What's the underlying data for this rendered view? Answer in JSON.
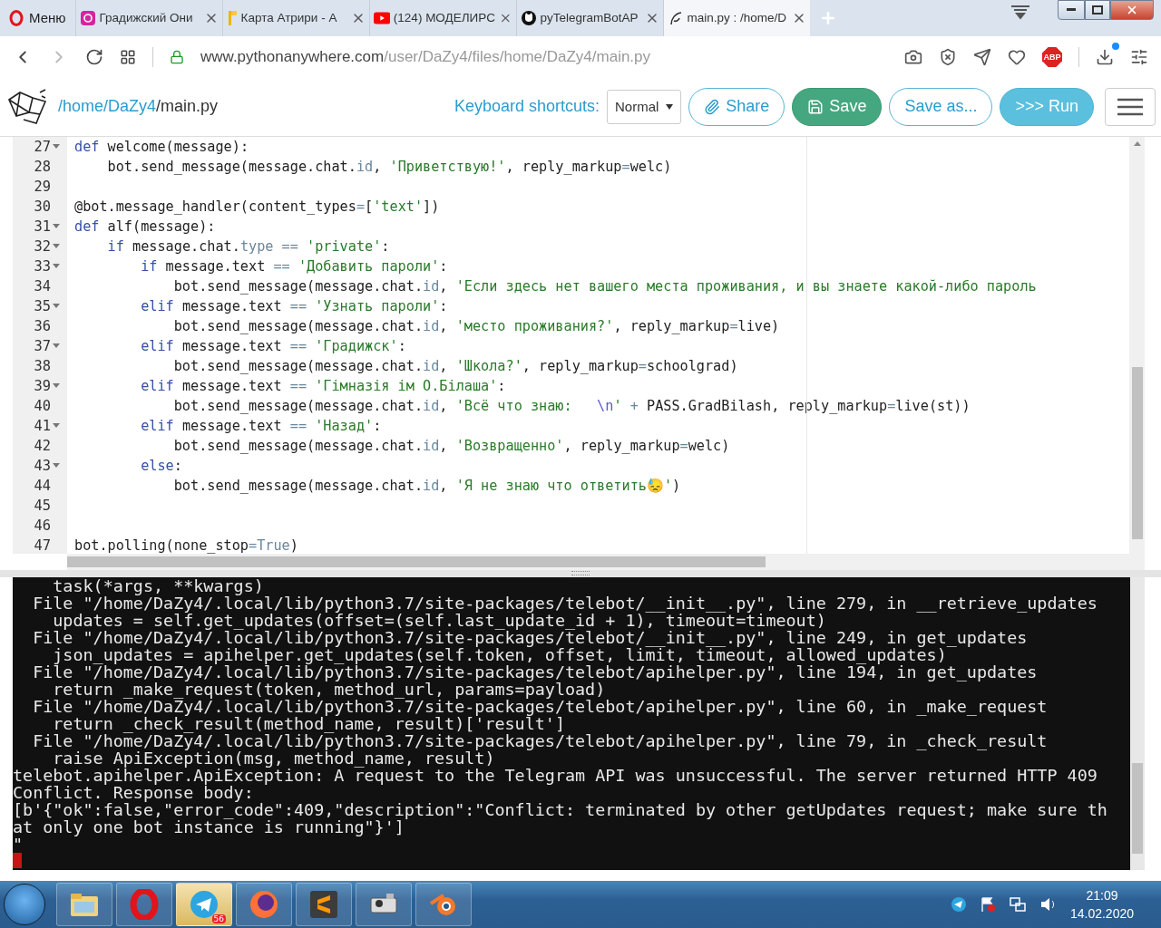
{
  "browser": {
    "menu_label": "Меню",
    "tabs": [
      {
        "title": "Градижский Они",
        "selected": false
      },
      {
        "title": "Карта Атрири - А",
        "selected": false
      },
      {
        "title": "(124) МОДЕЛИРС",
        "selected": false
      },
      {
        "title": "pyTelegramBotAP",
        "selected": false
      },
      {
        "title": "main.py : /home/D",
        "selected": true
      }
    ],
    "url": "www.pythonanywhere.com/user/DaZy4/files/home/DaZy4/main.py",
    "adblock_label": "ABP"
  },
  "header": {
    "breadcrumbs": [
      {
        "text": "/home",
        "kind": "link"
      },
      {
        "text": "/DaZy4",
        "kind": "link"
      },
      {
        "text": "/main.py",
        "kind": "current"
      }
    ],
    "shortcuts_label": "Keyboard shortcuts:",
    "shortcuts_mode": "Normal",
    "buttons": [
      {
        "label": "Share",
        "kind": "outline"
      },
      {
        "label": "Save",
        "kind": "success"
      },
      {
        "label": "Save as...",
        "kind": "outline"
      },
      {
        "label": ">>> Run",
        "kind": "info"
      }
    ]
  },
  "editor": {
    "lines": [
      {
        "number": "27",
        "foldable": true,
        "segments": [
          {
            "kind": "keyword",
            "text": "def"
          },
          {
            "kind": "plain",
            "text": " welcome(message):"
          }
        ]
      },
      {
        "number": "28",
        "foldable": false,
        "segments": [
          {
            "kind": "plain",
            "text": "    bot.send_message(message.chat."
          },
          {
            "kind": "attr",
            "text": "id"
          },
          {
            "kind": "plain",
            "text": ", "
          },
          {
            "kind": "string",
            "text": "'Приветствую!'"
          },
          {
            "kind": "plain",
            "text": ", reply_markup"
          },
          {
            "kind": "attr",
            "text": "="
          },
          {
            "kind": "plain",
            "text": "welc)"
          }
        ]
      },
      {
        "number": "29",
        "foldable": false
      },
      {
        "number": "30",
        "foldable": false,
        "segments": [
          {
            "kind": "plain",
            "text": "@bot.message_handler(content_types"
          },
          {
            "kind": "attr",
            "text": "="
          },
          {
            "kind": "plain",
            "text": "["
          },
          {
            "kind": "string",
            "text": "'text'"
          },
          {
            "kind": "plain",
            "text": "])"
          }
        ]
      },
      {
        "number": "31",
        "foldable": true,
        "segments": [
          {
            "kind": "keyword",
            "text": "def"
          },
          {
            "kind": "plain",
            "text": " alf(message):"
          }
        ]
      },
      {
        "number": "32",
        "foldable": true,
        "segments": [
          {
            "kind": "keyword",
            "text": "    if"
          },
          {
            "kind": "plain",
            "text": " message.chat."
          },
          {
            "kind": "attr",
            "text": "type == "
          },
          {
            "kind": "string",
            "text": "'private'"
          },
          {
            "kind": "plain",
            "text": ":"
          }
        ]
      },
      {
        "number": "33",
        "foldable": true,
        "segments": [
          {
            "kind": "keyword",
            "text": "        if"
          },
          {
            "kind": "plain",
            "text": " message.text "
          },
          {
            "kind": "attr",
            "text": "== "
          },
          {
            "kind": "string",
            "text": "'Добавить пароли'"
          },
          {
            "kind": "plain",
            "text": ":"
          }
        ]
      },
      {
        "number": "34",
        "foldable": false,
        "segments": [
          {
            "kind": "plain",
            "text": "            bot.send_message(message.chat."
          },
          {
            "kind": "attr",
            "text": "id"
          },
          {
            "kind": "plain",
            "text": ", "
          },
          {
            "kind": "string",
            "text": "'Если здесь нет вашего места проживания, и вы знаете какой-либо пароль"
          }
        ]
      },
      {
        "number": "35",
        "foldable": true,
        "segments": [
          {
            "kind": "keyword",
            "text": "        elif"
          },
          {
            "kind": "plain",
            "text": " message.text "
          },
          {
            "kind": "attr",
            "text": "== "
          },
          {
            "kind": "string",
            "text": "'Узнать пароли'"
          },
          {
            "kind": "plain",
            "text": ":"
          }
        ]
      },
      {
        "number": "36",
        "foldable": false,
        "segments": [
          {
            "kind": "plain",
            "text": "            bot.send_message(message.chat."
          },
          {
            "kind": "attr",
            "text": "id"
          },
          {
            "kind": "plain",
            "text": ", "
          },
          {
            "kind": "string",
            "text": "'место проживания?'"
          },
          {
            "kind": "plain",
            "text": ", reply_markup"
          },
          {
            "kind": "attr",
            "text": "="
          },
          {
            "kind": "plain",
            "text": "live)"
          }
        ]
      },
      {
        "number": "37",
        "foldable": true,
        "segments": [
          {
            "kind": "keyword",
            "text": "        elif"
          },
          {
            "kind": "plain",
            "text": " message.text "
          },
          {
            "kind": "attr",
            "text": "== "
          },
          {
            "kind": "string",
            "text": "'Градижск'"
          },
          {
            "kind": "plain",
            "text": ":"
          }
        ]
      },
      {
        "number": "38",
        "foldable": false,
        "segments": [
          {
            "kind": "plain",
            "text": "            bot.send_message(message.chat."
          },
          {
            "kind": "attr",
            "text": "id"
          },
          {
            "kind": "plain",
            "text": ", "
          },
          {
            "kind": "string",
            "text": "'Школа?'"
          },
          {
            "kind": "plain",
            "text": ", reply_markup"
          },
          {
            "kind": "attr",
            "text": "="
          },
          {
            "kind": "plain",
            "text": "schoolgrad)"
          }
        ]
      },
      {
        "number": "39",
        "foldable": true,
        "segments": [
          {
            "kind": "keyword",
            "text": "        elif"
          },
          {
            "kind": "plain",
            "text": " message.text "
          },
          {
            "kind": "attr",
            "text": "== "
          },
          {
            "kind": "string",
            "text": "'Гімназія ім О.Білаша'"
          },
          {
            "kind": "plain",
            "text": ":"
          }
        ]
      },
      {
        "number": "40",
        "foldable": false,
        "segments": [
          {
            "kind": "plain",
            "text": "            bot.send_message(message.chat."
          },
          {
            "kind": "attr",
            "text": "id"
          },
          {
            "kind": "plain",
            "text": ", "
          },
          {
            "kind": "string",
            "text": "'Всё что знаю:   "
          },
          {
            "kind": "escape",
            "text": "\\n"
          },
          {
            "kind": "string",
            "text": "'"
          },
          {
            "kind": "attr",
            "text": " +"
          },
          {
            "kind": "plain",
            "text": " PASS.GradBilash, reply_markup"
          },
          {
            "kind": "attr",
            "text": "="
          },
          {
            "kind": "plain",
            "text": "live(st))"
          }
        ]
      },
      {
        "number": "41",
        "foldable": true,
        "segments": [
          {
            "kind": "keyword",
            "text": "        elif"
          },
          {
            "kind": "plain",
            "text": " message.text "
          },
          {
            "kind": "attr",
            "text": "== "
          },
          {
            "kind": "string",
            "text": "'Назад'"
          },
          {
            "kind": "plain",
            "text": ":"
          }
        ]
      },
      {
        "number": "42",
        "foldable": false,
        "segments": [
          {
            "kind": "plain",
            "text": "            bot.send_message(message.chat."
          },
          {
            "kind": "attr",
            "text": "id"
          },
          {
            "kind": "plain",
            "text": ", "
          },
          {
            "kind": "string",
            "text": "'Возвращенно'"
          },
          {
            "kind": "plain",
            "text": ", reply_markup"
          },
          {
            "kind": "attr",
            "text": "="
          },
          {
            "kind": "plain",
            "text": "welc)"
          }
        ]
      },
      {
        "number": "43",
        "foldable": true,
        "segments": [
          {
            "kind": "keyword",
            "text": "        else"
          },
          {
            "kind": "plain",
            "text": ":"
          }
        ]
      },
      {
        "number": "44",
        "foldable": false,
        "segments": [
          {
            "kind": "plain",
            "text": "            bot.send_message(message.chat."
          },
          {
            "kind": "attr",
            "text": "id"
          },
          {
            "kind": "plain",
            "text": ", "
          },
          {
            "kind": "string",
            "text": "'Я не знаю что ответить😓'"
          },
          {
            "kind": "plain",
            "text": ")"
          }
        ]
      },
      {
        "number": "45",
        "foldable": false
      },
      {
        "number": "46",
        "foldable": false
      },
      {
        "number": "47",
        "foldable": false,
        "segments": [
          {
            "kind": "plain",
            "text": "bot.polling(none_stop"
          },
          {
            "kind": "attr",
            "text": "="
          },
          {
            "kind": "attr",
            "text": "True"
          },
          {
            "kind": "plain",
            "text": ")"
          }
        ]
      }
    ]
  },
  "console": {
    "lines": [
      "    task(*args, **kwargs)",
      "  File \"/home/DaZy4/.local/lib/python3.7/site-packages/telebot/__init__.py\", line 279, in __retrieve_updates",
      "    updates = self.get_updates(offset=(self.last_update_id + 1), timeout=timeout)",
      "  File \"/home/DaZy4/.local/lib/python3.7/site-packages/telebot/__init__.py\", line 249, in get_updates",
      "    json_updates = apihelper.get_updates(self.token, offset, limit, timeout, allowed_updates)",
      "  File \"/home/DaZy4/.local/lib/python3.7/site-packages/telebot/apihelper.py\", line 194, in get_updates",
      "    return _make_request(token, method_url, params=payload)",
      "  File \"/home/DaZy4/.local/lib/python3.7/site-packages/telebot/apihelper.py\", line 60, in _make_request",
      "    return _check_result(method_name, result)['result']",
      "  File \"/home/DaZy4/.local/lib/python3.7/site-packages/telebot/apihelper.py\", line 79, in _check_result",
      "    raise ApiException(msg, method_name, result)",
      "telebot.apihelper.ApiException: A request to the Telegram API was unsuccessful. The server returned HTTP 409",
      "Conflict. Response body:",
      "[b'{\"ok\":false,\"error_code\":409,\"description\":\"Conflict: terminated by other getUpdates request; make sure th",
      "at only one bot instance is running\"}']",
      "\""
    ]
  },
  "taskbar": {
    "apps": [
      {
        "selected": false
      },
      {
        "selected": false
      },
      {
        "selected": true,
        "badge": "56"
      },
      {
        "selected": false
      },
      {
        "selected": false
      },
      {
        "selected": false
      },
      {
        "selected": false
      }
    ],
    "time": "21:09",
    "date": "14.02.2020"
  }
}
